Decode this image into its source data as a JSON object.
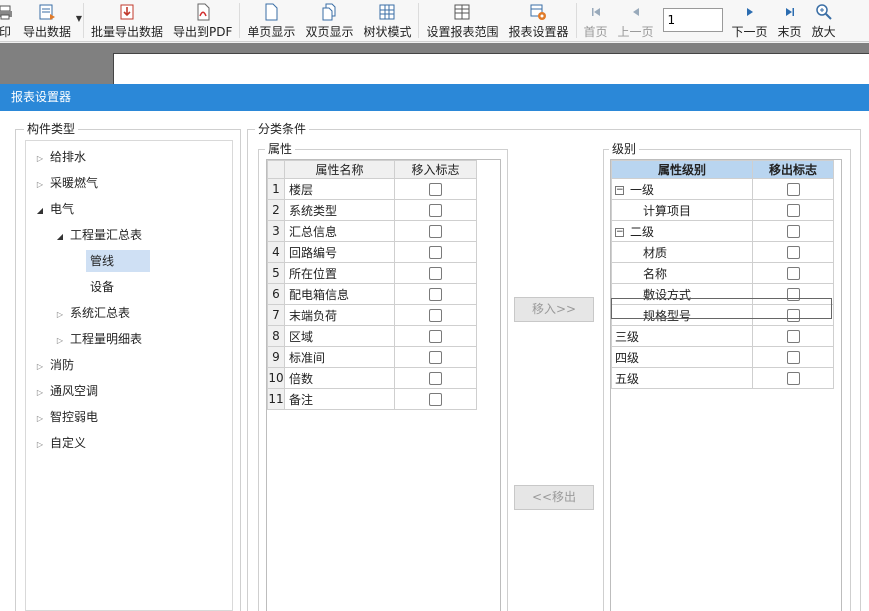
{
  "toolbar": {
    "items": [
      {
        "label": "印",
        "icon": "printer-icon",
        "disabled": false
      },
      {
        "label": "导出数据",
        "icon": "export-data-icon",
        "disabled": false,
        "dropdown": true
      },
      {
        "label": "批量导出数据",
        "icon": "batch-export-icon",
        "disabled": false
      },
      {
        "label": "导出到PDF",
        "icon": "pdf-icon",
        "disabled": false
      },
      {
        "label": "单页显示",
        "icon": "single-page-icon",
        "disabled": false
      },
      {
        "label": "双页显示",
        "icon": "double-page-icon",
        "disabled": false
      },
      {
        "label": "树状模式",
        "icon": "tree-mode-icon",
        "disabled": false
      },
      {
        "label": "设置报表范围",
        "icon": "report-range-icon",
        "disabled": false
      },
      {
        "label": "报表设置器",
        "icon": "report-settings-icon",
        "disabled": false
      },
      {
        "label": "首页",
        "icon": "first-page-icon",
        "disabled": true
      },
      {
        "label": "上一页",
        "icon": "prev-page-icon",
        "disabled": true
      },
      {
        "label": "下一页",
        "icon": "next-page-icon",
        "disabled": false
      },
      {
        "label": "末页",
        "icon": "last-page-icon",
        "disabled": false
      },
      {
        "label": "放大",
        "icon": "zoom-in-icon",
        "disabled": false
      }
    ],
    "page_value": "1"
  },
  "dialog": {
    "title": "报表设置器",
    "component_type": {
      "title": "构件类型",
      "tree": [
        {
          "label": "给排水",
          "level": 0,
          "state": "collapsed"
        },
        {
          "label": "采暖燃气",
          "level": 0,
          "state": "collapsed"
        },
        {
          "label": "电气",
          "level": 0,
          "state": "expanded"
        },
        {
          "label": "工程量汇总表",
          "level": 1,
          "state": "expanded"
        },
        {
          "label": "管线",
          "level": 2,
          "state": "leaf",
          "selected": true
        },
        {
          "label": "设备",
          "level": 2,
          "state": "leaf"
        },
        {
          "label": "系统汇总表",
          "level": 1,
          "state": "collapsed"
        },
        {
          "label": "工程量明细表",
          "level": 1,
          "state": "collapsed"
        },
        {
          "label": "消防",
          "level": 0,
          "state": "collapsed"
        },
        {
          "label": "通风空调",
          "level": 0,
          "state": "collapsed"
        },
        {
          "label": "智控弱电",
          "level": 0,
          "state": "collapsed"
        },
        {
          "label": "自定义",
          "level": 0,
          "state": "collapsed"
        }
      ]
    },
    "classification": {
      "title": "分类条件",
      "attributes": {
        "title": "属性",
        "col_name": "属性名称",
        "col_flag": "移入标志",
        "rows": [
          {
            "num": "1",
            "name": "楼层"
          },
          {
            "num": "2",
            "name": "系统类型"
          },
          {
            "num": "3",
            "name": "汇总信息"
          },
          {
            "num": "4",
            "name": "回路编号"
          },
          {
            "num": "5",
            "name": "所在位置"
          },
          {
            "num": "6",
            "name": "配电箱信息"
          },
          {
            "num": "7",
            "name": "末端负荷"
          },
          {
            "num": "8",
            "name": "区域"
          },
          {
            "num": "9",
            "name": "标准间"
          },
          {
            "num": "10",
            "name": "倍数"
          },
          {
            "num": "11",
            "name": "备注"
          }
        ]
      },
      "move_in_label": "移入>>",
      "move_out_label": "<<移出",
      "levels": {
        "title": "级别",
        "col_level": "属性级别",
        "col_flag": "移出标志",
        "rows": [
          {
            "label": "一级",
            "indent": 0,
            "toggle": "−",
            "check": true
          },
          {
            "label": "计算项目",
            "indent": 1,
            "check": true
          },
          {
            "label": "二级",
            "indent": 0,
            "toggle": "−",
            "check": true
          },
          {
            "label": "材质",
            "indent": 1,
            "check": true
          },
          {
            "label": "名称",
            "indent": 1,
            "check": true
          },
          {
            "label": "敷设方式",
            "indent": 1,
            "check": true,
            "focused": true
          },
          {
            "label": "规格型号",
            "indent": 1,
            "check": true
          },
          {
            "label": "三级",
            "indent": 0,
            "check": true
          },
          {
            "label": "四级",
            "indent": 0,
            "check": true
          },
          {
            "label": "五级",
            "indent": 0,
            "check": true
          }
        ]
      }
    }
  },
  "colors": {
    "title_bar": "#2b88d8",
    "level_header": "#b9d5f0",
    "selected_tree": "#cfe0f4"
  }
}
